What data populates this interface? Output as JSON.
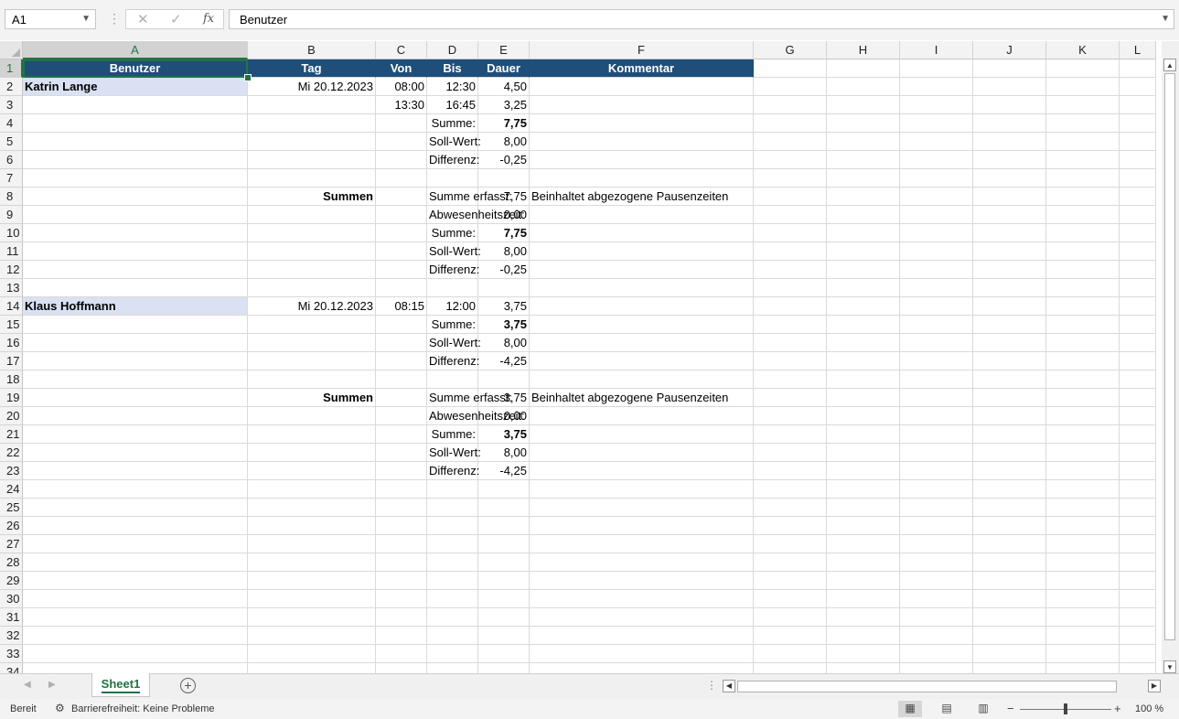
{
  "name_box": "A1",
  "formula_bar": {
    "content": "Benutzer",
    "cancel_icon": "✕",
    "enter_icon": "✓",
    "fx_label": "fx"
  },
  "columns": [
    {
      "id": "A",
      "label": "A"
    },
    {
      "id": "B",
      "label": "B"
    },
    {
      "id": "C",
      "label": "C"
    },
    {
      "id": "D",
      "label": "D"
    },
    {
      "id": "E",
      "label": "E"
    },
    {
      "id": "F",
      "label": "F"
    },
    {
      "id": "G",
      "label": "G"
    },
    {
      "id": "H",
      "label": "H"
    },
    {
      "id": "I",
      "label": "I"
    },
    {
      "id": "J",
      "label": "J"
    },
    {
      "id": "K",
      "label": "K"
    },
    {
      "id": "L",
      "label": "L"
    }
  ],
  "rows": [
    {
      "n": "1",
      "A": "Benutzer",
      "B": "Tag",
      "C": "Von",
      "D": "Bis",
      "E": "Dauer",
      "F": "Kommentar"
    },
    {
      "n": "2",
      "A": "Katrin Lange",
      "B": "Mi 20.12.2023",
      "C": "08:00",
      "D": "12:30",
      "E": "4,50",
      "F": ""
    },
    {
      "n": "3",
      "A": "",
      "B": "",
      "C": "13:30",
      "D": "16:45",
      "E": "3,25",
      "F": ""
    },
    {
      "n": "4",
      "A": "",
      "B": "",
      "C": "",
      "D": "Summe:",
      "E": "7,75",
      "F": ""
    },
    {
      "n": "5",
      "A": "",
      "B": "",
      "C": "",
      "D": "Soll-Wert:",
      "E": "8,00",
      "F": ""
    },
    {
      "n": "6",
      "A": "",
      "B": "",
      "C": "",
      "D": "Differenz:",
      "E": "-0,25",
      "F": ""
    },
    {
      "n": "7",
      "A": "",
      "B": "",
      "C": "",
      "D": "",
      "E": "",
      "F": ""
    },
    {
      "n": "8",
      "A": "",
      "B": "Summen",
      "C": "",
      "D": "Summe erfasst:",
      "E": "7,75",
      "F": "Beinhaltet abgezogene Pausenzeiten"
    },
    {
      "n": "9",
      "A": "",
      "B": "",
      "C": "",
      "D": "Abwesenheitszeit:",
      "E": "0,00",
      "F": ""
    },
    {
      "n": "10",
      "A": "",
      "B": "",
      "C": "",
      "D": "Summe:",
      "E": "7,75",
      "F": ""
    },
    {
      "n": "11",
      "A": "",
      "B": "",
      "C": "",
      "D": "Soll-Wert:",
      "E": "8,00",
      "F": ""
    },
    {
      "n": "12",
      "A": "",
      "B": "",
      "C": "",
      "D": "Differenz:",
      "E": "-0,25",
      "F": ""
    },
    {
      "n": "13",
      "A": "",
      "B": "",
      "C": "",
      "D": "",
      "E": "",
      "F": ""
    },
    {
      "n": "14",
      "A": "Klaus Hoffmann",
      "B": "Mi 20.12.2023",
      "C": "08:15",
      "D": "12:00",
      "E": "3,75",
      "F": ""
    },
    {
      "n": "15",
      "A": "",
      "B": "",
      "C": "",
      "D": "Summe:",
      "E": "3,75",
      "F": ""
    },
    {
      "n": "16",
      "A": "",
      "B": "",
      "C": "",
      "D": "Soll-Wert:",
      "E": "8,00",
      "F": ""
    },
    {
      "n": "17",
      "A": "",
      "B": "",
      "C": "",
      "D": "Differenz:",
      "E": "-4,25",
      "F": ""
    },
    {
      "n": "18",
      "A": "",
      "B": "",
      "C": "",
      "D": "",
      "E": "",
      "F": ""
    },
    {
      "n": "19",
      "A": "",
      "B": "Summen",
      "C": "",
      "D": "Summe erfasst:",
      "E": "3,75",
      "F": "Beinhaltet abgezogene Pausenzeiten"
    },
    {
      "n": "20",
      "A": "",
      "B": "",
      "C": "",
      "D": "Abwesenheitszeit:",
      "E": "0,00",
      "F": ""
    },
    {
      "n": "21",
      "A": "",
      "B": "",
      "C": "",
      "D": "Summe:",
      "E": "3,75",
      "F": ""
    },
    {
      "n": "22",
      "A": "",
      "B": "",
      "C": "",
      "D": "Soll-Wert:",
      "E": "8,00",
      "F": ""
    },
    {
      "n": "23",
      "A": "",
      "B": "",
      "C": "",
      "D": "Differenz:",
      "E": "-4,25",
      "F": ""
    },
    {
      "n": "24"
    },
    {
      "n": "25"
    },
    {
      "n": "26"
    },
    {
      "n": "27"
    },
    {
      "n": "28"
    },
    {
      "n": "29"
    },
    {
      "n": "30"
    },
    {
      "n": "31"
    },
    {
      "n": "32"
    },
    {
      "n": "33"
    },
    {
      "n": "34"
    }
  ],
  "sheet_tab": "Sheet1",
  "add_sheet_label": "+",
  "status": {
    "ready": "Bereit",
    "accessibility": "Barrierefreiheit: Keine Probleme",
    "zoom": "100 %"
  },
  "colors": {
    "header_fill": "#1f4e79",
    "user_fill": "#d9e1f2",
    "excel_green": "#217346"
  }
}
